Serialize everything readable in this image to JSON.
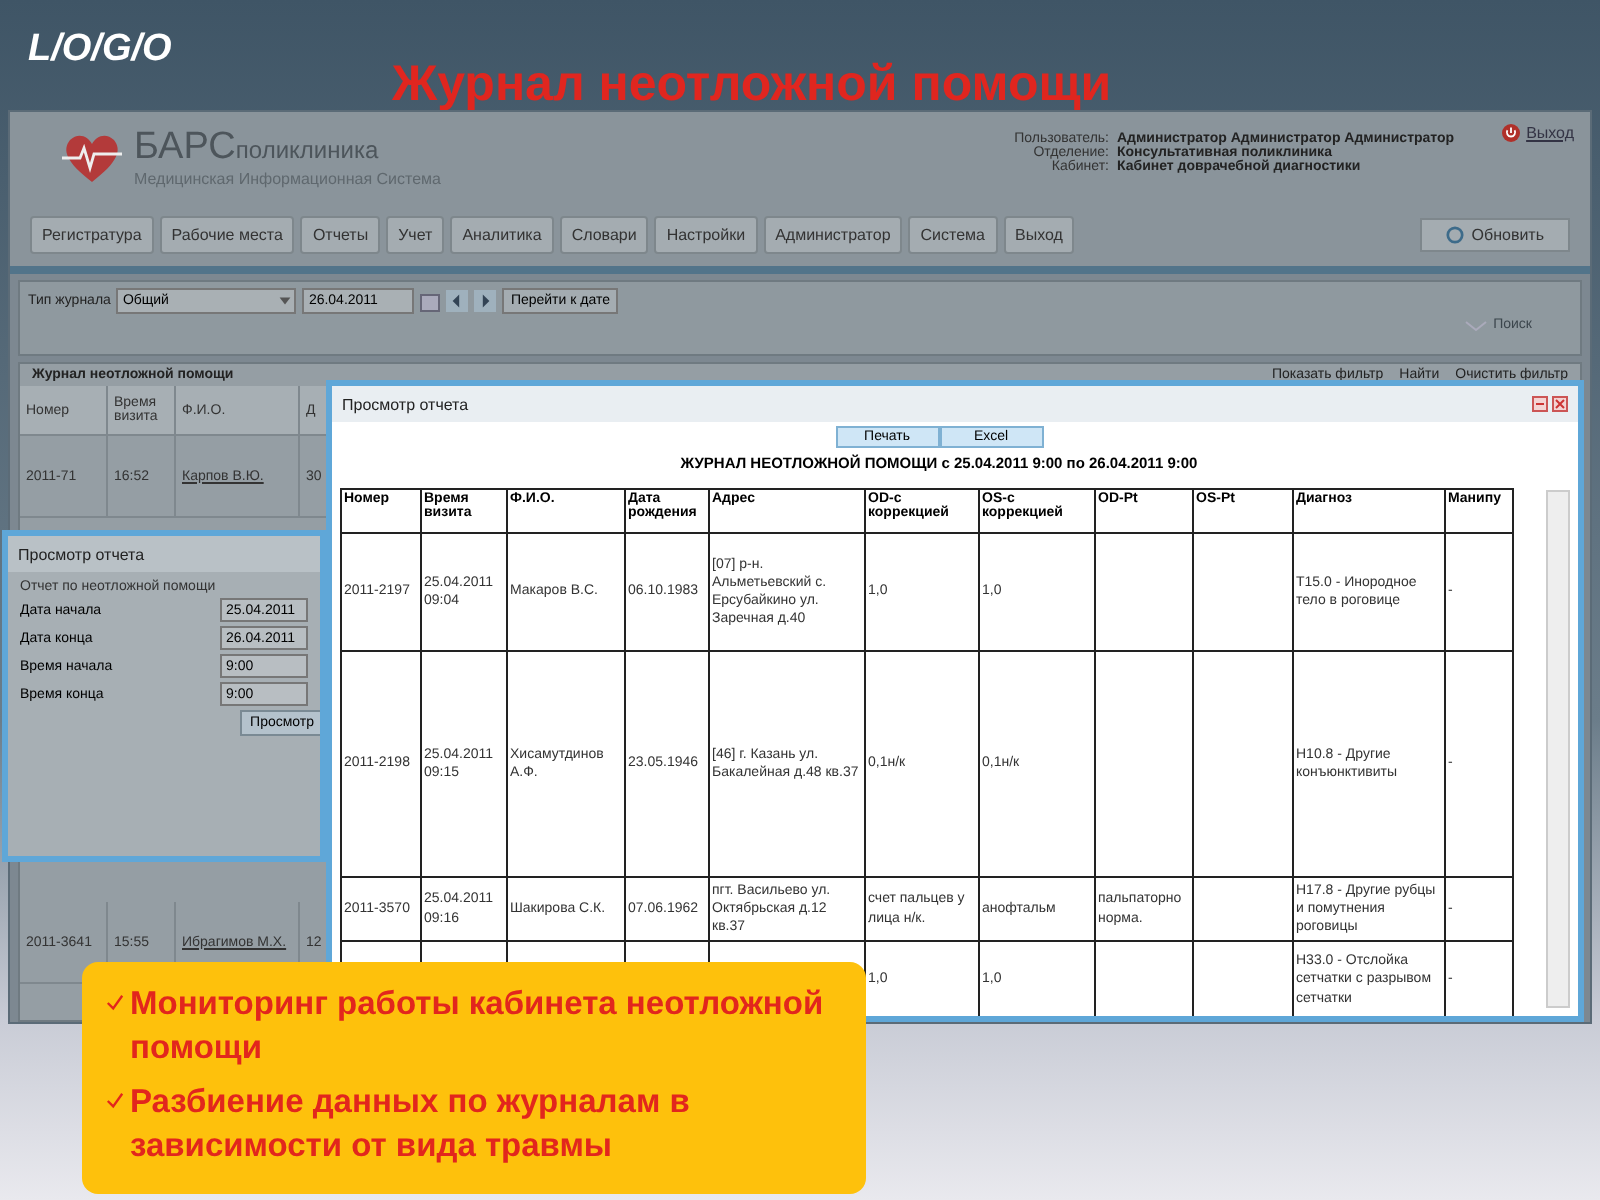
{
  "slide": {
    "logo": "L/O/G/O",
    "title": "Журнал неотложной помощи"
  },
  "app": {
    "brand": {
      "name": "БАРС",
      "product": "поликлиника",
      "subtitle": "Медицинская Информационная Система"
    },
    "user_info": [
      {
        "label": "Пользователь:",
        "value": "Администратор Администратор Администратор"
      },
      {
        "label": "Отделение:",
        "value": "Консультативная поликлиника"
      },
      {
        "label": "Кабинет:",
        "value": "Кабинет доврачебной диагностики"
      }
    ],
    "logout": "Выход",
    "menu": [
      "Регистратура",
      "Рабочие места",
      "Отчеты",
      "Учет",
      "Аналитика",
      "Словари",
      "Настройки",
      "Администратор",
      "Система",
      "Выход"
    ],
    "refresh": "Обновить",
    "toolbar": {
      "journal_type_label": "Тип журнала",
      "journal_type": "Общий",
      "date": "26.04.2011",
      "goto_date": "Перейти к дате",
      "search": "Поиск"
    },
    "grid": {
      "title": "Журнал неотложной помощи",
      "actions": [
        "Показать фильтр",
        "Найти",
        "Очистить фильтр"
      ],
      "columns": [
        "Номер",
        "Время визита",
        "Ф.И.О.",
        "Д"
      ],
      "rows": [
        [
          "2011-71",
          "16:52",
          "Карпов В.Ю.",
          "30"
        ],
        [
          "2011-3641",
          "15:55",
          "Ибрагимов М.Х.",
          "12"
        ]
      ]
    }
  },
  "params_dialog": {
    "title": "Просмотр отчета",
    "heading": "Отчет по неотложной помощи",
    "fields": [
      {
        "label": "Дата начала",
        "value": "25.04.2011"
      },
      {
        "label": "Дата конца",
        "value": "26.04.2011"
      },
      {
        "label": "Время начала",
        "value": "9:00"
      },
      {
        "label": "Время конца",
        "value": "9:00"
      }
    ],
    "submit": "Просмотр"
  },
  "report_dialog": {
    "title": "Просмотр отчета",
    "buttons": [
      "Печать",
      "Excel"
    ],
    "report_title": "ЖУРНАЛ НЕОТЛОЖНОЙ ПОМОЩИ с 25.04.2011 9:00 по 26.04.2011 9:00",
    "columns": [
      "Номер",
      "Время визита",
      "Ф.И.О.",
      "Дата рождения",
      "Адрес",
      "OD-с коррекцией",
      "OS-с коррекцией",
      "OD-Pt",
      "OS-Pt",
      "Диагноз",
      "Манипу"
    ],
    "rows": [
      [
        "2011-2197",
        "25.04.2011 09:04",
        "Макаров В.С.",
        "06.10.1983",
        "[07] р-н. Альметьевский с. Ерсубайкино ул. Заречная д.40",
        "1,0",
        "1,0",
        null,
        null,
        "T15.0 - Инородное тело в роговице",
        "-"
      ],
      [
        "2011-2198",
        "25.04.2011 09:15",
        "Хисамутдинов А.Ф.",
        "23.05.1946",
        "[46] г. Казань ул. Бакалейная д.48 кв.37",
        "0,1н/к",
        "0,1н/к",
        null,
        null,
        "H10.8 - Другие конъюнктивиты",
        "-"
      ],
      [
        "2011-3570",
        "25.04.2011 09:16",
        "Шакирова С.К.",
        "07.06.1962",
        "пгт. Васильево ул. Октябрьская д.12 кв.37",
        "счет пальцев у лица н/к.",
        "анофтальм",
        "пальпаторно норма.",
        null,
        "H17.8 - Другие рубцы и помутнения роговицы",
        "-"
      ],
      [
        null,
        null,
        null,
        null,
        null,
        "1,0",
        "1,0",
        null,
        null,
        "H33.0 - Отслойка сетчатки с разрывом сетчатки",
        "-"
      ]
    ]
  },
  "callout": {
    "items": [
      "Мониторинг работы кабинета неотложной помощи",
      "Разбиение данных по журналам в зависимости от вида травмы"
    ]
  }
}
